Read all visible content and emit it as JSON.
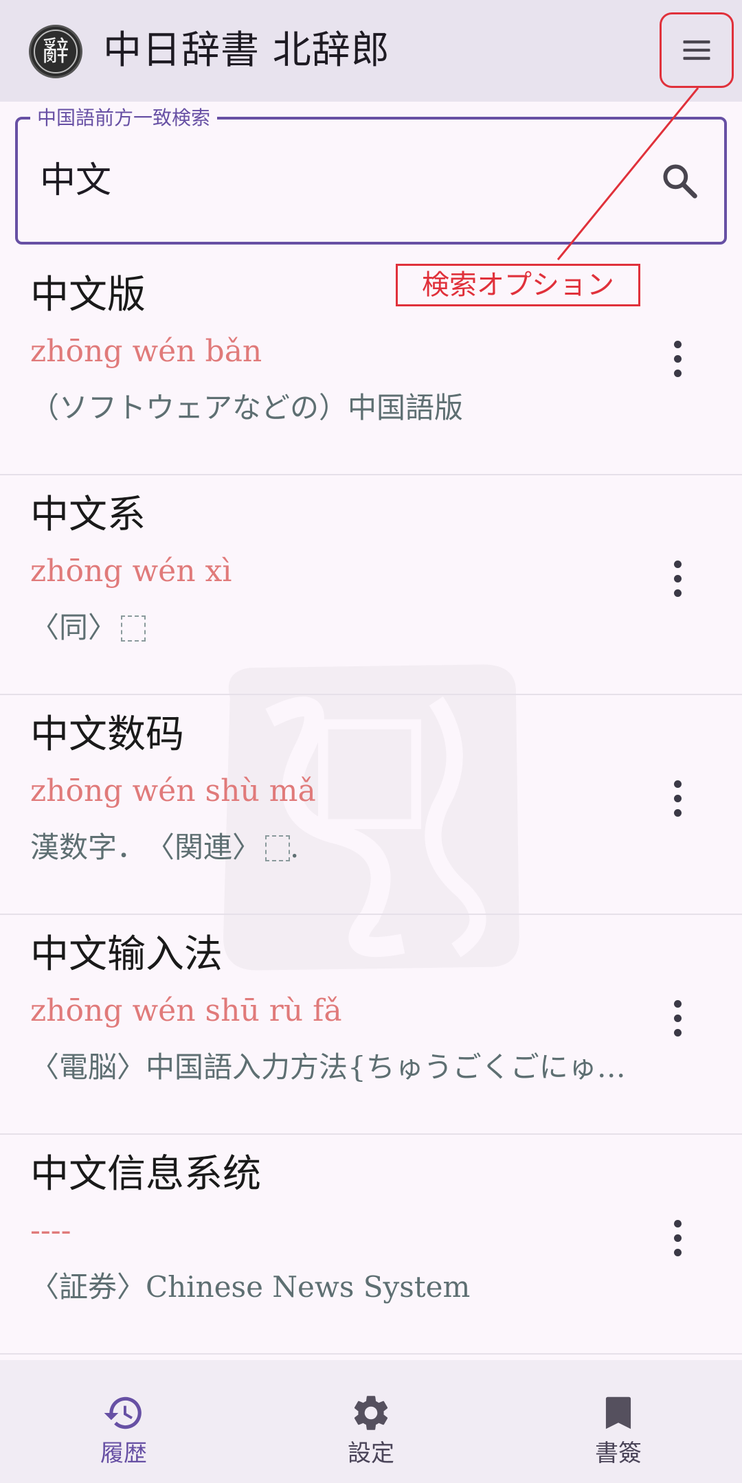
{
  "header": {
    "logo_char": "辭",
    "title": "中日辞書 北辞郎",
    "menu_icon": "hamburger-menu-icon"
  },
  "search": {
    "label": "中国語前方一致検索",
    "value": "中文",
    "icon": "search-icon"
  },
  "annotation": {
    "text": "検索オプション",
    "color": "#e0313b"
  },
  "results": [
    {
      "headword": "中文版",
      "pinyin": "zhōng wén bǎn",
      "meaning": "（ソフトウェアなどの）中国語版"
    },
    {
      "headword": "中文系",
      "pinyin": "zhōng wén xì",
      "meaning": "〈同〉"
    },
    {
      "headword": "中文数码",
      "pinyin": "zhōng wén shù mǎ",
      "meaning": "漢数字．　〈関連〉",
      "meaning_suffix": "."
    },
    {
      "headword": "中文输入法",
      "pinyin": "zhōng wén shū rù fǎ",
      "meaning": "〈電脳〉中国語入力方法{ちゅうごくごにゅ…"
    },
    {
      "headword": "中文信息系统",
      "pinyin": "----",
      "meaning": "〈証券〉Chinese News System"
    }
  ],
  "bottom_nav": {
    "items": [
      {
        "label": "履歴",
        "icon": "history-icon",
        "active": true
      },
      {
        "label": "設定",
        "icon": "gear-icon",
        "active": false
      },
      {
        "label": "書簽",
        "icon": "bookmark-icon",
        "active": false
      }
    ]
  },
  "colors": {
    "accent": "#6750a4",
    "pinyin": "#e07a7a",
    "meaning": "#5e6f72",
    "header_bg": "#e8e3ee"
  }
}
